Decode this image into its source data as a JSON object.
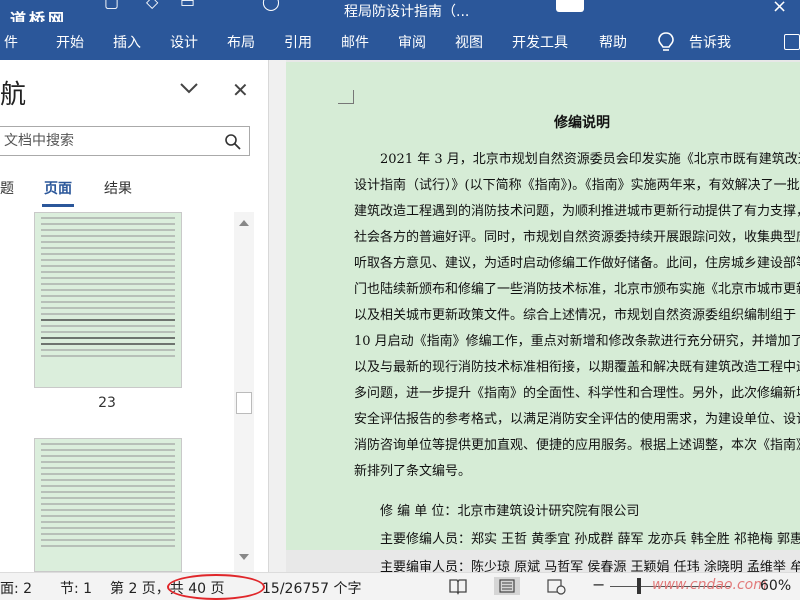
{
  "titlebar": {
    "watermark": "道桥网",
    "title": "程局防设计指南（..."
  },
  "ribbon": {
    "tabs": [
      "件",
      "开始",
      "插入",
      "设计",
      "布局",
      "引用",
      "邮件",
      "审阅",
      "视图",
      "开发工具",
      "帮助",
      "告诉我"
    ]
  },
  "nav": {
    "title": "航",
    "search_placeholder": "文档中搜索",
    "tabs": [
      "题",
      "页面",
      "结果"
    ],
    "thumb_page_number": "23"
  },
  "document": {
    "heading": "修编说明",
    "paragraph_lines": [
      "2021 年 3 月，北京市规划自然资源委员会印发实施《北京市既有建筑改造工程消",
      "设计指南（试行）》(以下简称《指南》)。《指南》实施两年来，有效解决了一批制约既",
      "建筑改造工程遇到的消防技术问题，为顺利推进城市更新行动提供了有力支撑，受到",
      "社会各方的普遍好评。同时，市规划自然资源委持续开展跟踪问效，收集典型应用案例",
      "听取各方意见、建议，为适时启动修编工作做好储备。此间，住房城乡建设部等有关",
      "门也陆续新颁布和修编了一些消防技术标准，北京市颁布实施《北京市城市更新条",
      "以及相关城市更新政策文件。综合上述情况，市规划自然资源委组织编制组于 2022",
      "10 月启动《指南》修编工作，重点对新增和修改条款进行充分研究，并增加了条文说明",
      "以及与最新的现行消防技术标准相衔接，以期覆盖和解决既有建筑改造工程中遇到的",
      "多问题，进一步提升《指南》的全面性、科学性和合理性。另外，此次修编新增了消",
      "安全评估报告的参考格式，以满足消防安全评估的使用需求，为建设单位、设计单位",
      "消防咨询单位等提供更加直观、便捷的应用服务。根据上述调整，本次《指南》修编",
      "新排列了条文编号。"
    ],
    "editor_unit_line": "修    编  单  位：北京市建筑设计研究院有限公司",
    "main_editors_line": "主要修编人员：郑实  王哲  黄季宜  孙成群  薛军  龙亦兵  韩全胜  祁艳梅  郭惠琴",
    "main_reviewers_line": "主要编审人员：陈少琼  原斌  马哲军  侯春源  王颖娟  任玮  涂晓明  孟维举  牟胜"
  },
  "statusbar": {
    "section_label": "面: 2",
    "section": "节: 1",
    "page": "第 2 页，共 40 页",
    "words": "15/26757 个字",
    "watermark": "www.cndao.com",
    "zoom": "60%"
  }
}
